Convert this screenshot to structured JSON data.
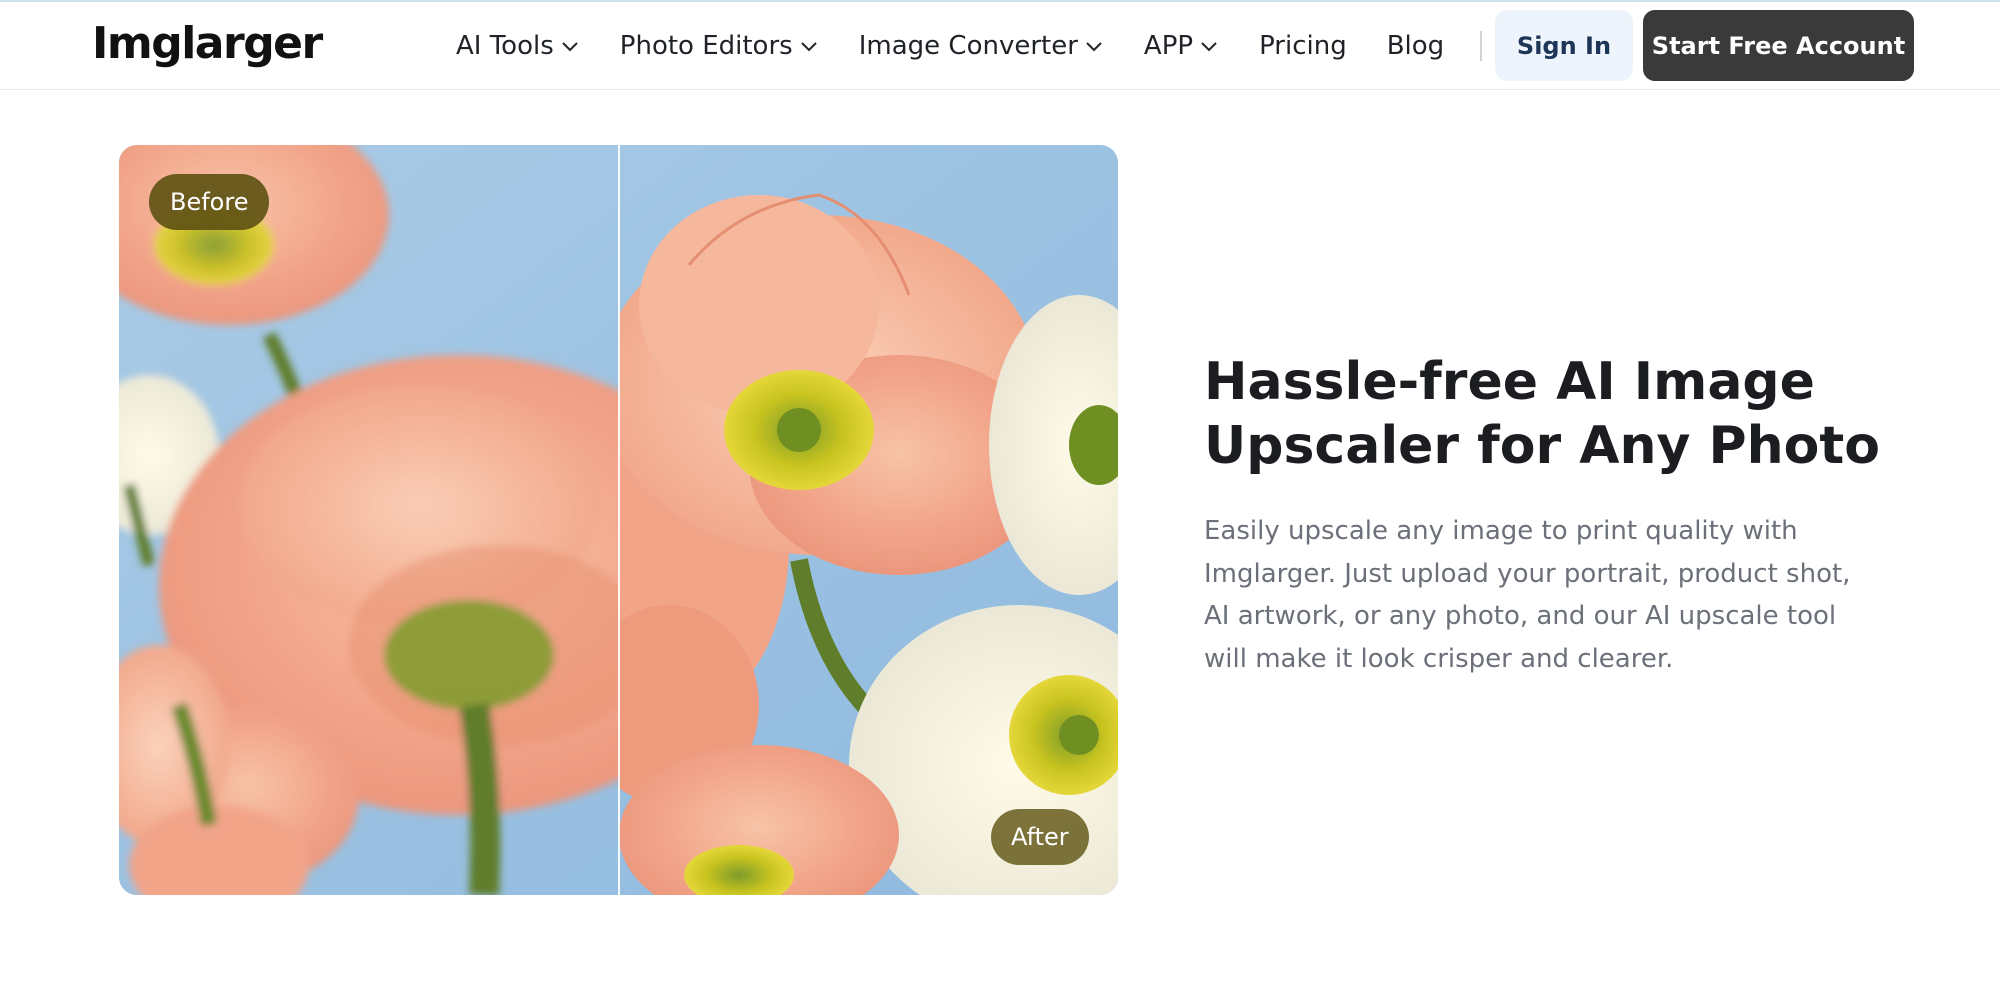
{
  "brand": {
    "logo_text": "Imglarger"
  },
  "nav": {
    "items": [
      {
        "label": "AI Tools",
        "dropdown": true
      },
      {
        "label": "Photo Editors",
        "dropdown": true
      },
      {
        "label": "Image Converter",
        "dropdown": true
      },
      {
        "label": "APP",
        "dropdown": true
      },
      {
        "label": "Pricing",
        "dropdown": false
      },
      {
        "label": "Blog",
        "dropdown": false
      }
    ],
    "sign_in": "Sign In",
    "cta": "Start Free Account"
  },
  "compare": {
    "before_label": "Before",
    "after_label": "After"
  },
  "hero": {
    "title": "Hassle-free AI Image Upscaler for Any Photo",
    "description": "Easily upscale any image to print quality with Imglarger. Just upload your portrait, product shot, AI artwork, or any photo, and our AI upscale tool will make it look crisper and clearer."
  },
  "colors": {
    "cta_bg": "#3a3a3a",
    "signin_bg": "#eef4fb",
    "badge_bg": "#605214",
    "sky": "#9cc3e4",
    "petal": "#f2a98a"
  },
  "icons": {
    "dropdown": "chevron-down-icon"
  }
}
